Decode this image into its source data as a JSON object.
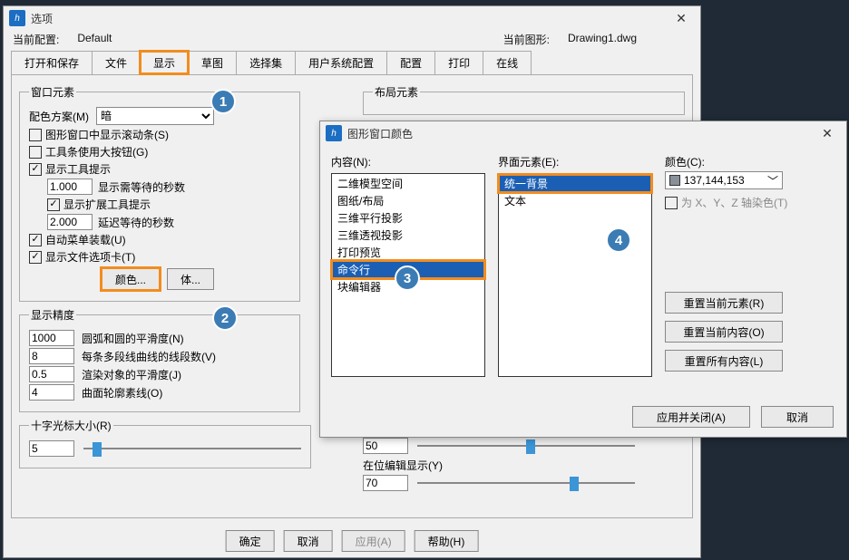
{
  "win1": {
    "title": "选项",
    "currentProfileLabel": "当前配置:",
    "currentProfile": "Default",
    "currentDrawingLabel": "当前图形:",
    "currentDrawing": "Drawing1.dwg",
    "tabs": [
      "打开和保存",
      "文件",
      "显示",
      "草图",
      "选择集",
      "用户系统配置",
      "配置",
      "打印",
      "在线"
    ],
    "activeTab": "显示",
    "windowElements": {
      "legend": "窗口元素",
      "colorSchemeLabel": "配色方案(M)",
      "colorScheme": "暗",
      "showScroll": "图形窗口中显示滚动条(S)",
      "largeButtons": "工具条使用大按钮(G)",
      "showTooltips": "显示工具提示",
      "tooltipDelay": "1.000",
      "tooltipDelayLabel": "显示需等待的秒数",
      "extTooltips": "显示扩展工具提示",
      "extDelay": "2.000",
      "extDelayLabel": "延迟等待的秒数",
      "autoMenu": "自动菜单装载(U)",
      "fileTabs": "显示文件选项卡(T)",
      "colorsBtn": "颜色...",
      "fontsBtn": "体..."
    },
    "displayAccuracy": {
      "legend": "显示精度",
      "arc": "1000",
      "arcLabel": "圆弧和圆的平滑度(N)",
      "poly": "8",
      "polyLabel": "每条多段线曲线的线段数(V)",
      "render": "0.5",
      "renderLabel": "渲染对象的平滑度(J)",
      "surf": "4",
      "surfLabel": "曲面轮廓素线(O)"
    },
    "crosshair": {
      "label": "十字光标大小(R)",
      "value": "5"
    },
    "layout": {
      "legend": "布局元素",
      "sliderA": "50",
      "inplaceEdit": "在位编辑显示(Y)",
      "sliderB": "70"
    },
    "buttons": {
      "ok": "确定",
      "cancel": "取消",
      "apply": "应用(A)",
      "help": "帮助(H)"
    }
  },
  "win2": {
    "title": "图形窗口颜色",
    "contentLabel": "内容(N):",
    "contentItems": [
      "二维模型空间",
      "图纸/布局",
      "三维平行投影",
      "三维透视投影",
      "打印预览",
      "命令行",
      "块编辑器"
    ],
    "elemLabel": "界面元素(E):",
    "elemItems": [
      "统一背景",
      "文本"
    ],
    "colorLabel": "颜色(C):",
    "colorValue": "137,144,153",
    "tintXYZ": "为 X、Y、Z 轴染色(T)",
    "resetElem": "重置当前元素(R)",
    "resetContent": "重置当前内容(O)",
    "resetAll": "重置所有内容(L)",
    "applyClose": "应用并关闭(A)",
    "cancel": "取消"
  },
  "badges": [
    "1",
    "2",
    "3",
    "4"
  ]
}
